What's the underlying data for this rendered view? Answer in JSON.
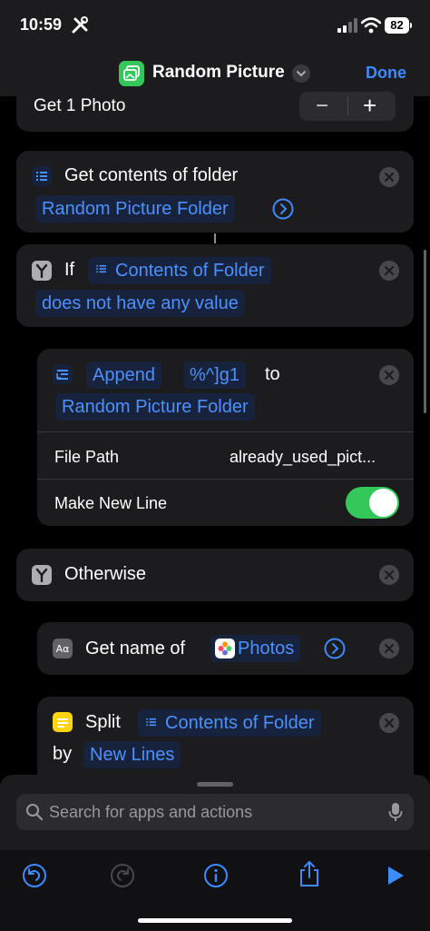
{
  "status": {
    "time": "10:59",
    "battery": "82"
  },
  "nav": {
    "title": "Random Picture",
    "done": "Done"
  },
  "get_photo": {
    "label": "Get 1 Photo",
    "minus": "−",
    "plus": "+"
  },
  "folder_action": {
    "label": "Get contents of folder",
    "folder": "Random Picture Folder"
  },
  "if_action": {
    "keyword": "If",
    "var": "Contents of Folder",
    "condition": "does not have any value"
  },
  "append_action": {
    "verb": "Append",
    "value": "%^]g1",
    "to": "to",
    "target": "Random Picture Folder",
    "file_path_label": "File Path",
    "file_path_value": "already_used_pict...",
    "new_line_label": "Make New Line",
    "new_line_on": true
  },
  "otherwise": {
    "label": "Otherwise"
  },
  "get_name": {
    "label": "Get name of",
    "value": "Photos"
  },
  "split": {
    "verb": "Split",
    "var": "Contents of Folder",
    "by": "by",
    "sep": "New Lines"
  },
  "search": {
    "placeholder": "Search for apps and actions"
  },
  "colors": {
    "accent": "#3d8bff",
    "toggle_on": "#34c759",
    "card": "#1c1c1e"
  },
  "icons": [
    "tools-icon",
    "signal-icon",
    "wifi-icon",
    "battery-icon",
    "photo-app-icon",
    "chevron-down-icon",
    "list-icon",
    "branch-icon",
    "append-icon",
    "text-icon",
    "photos-icon",
    "note-icon",
    "close-icon",
    "arrow-right-icon",
    "search-icon",
    "mic-icon",
    "undo-icon",
    "redo-icon",
    "info-icon",
    "share-icon",
    "play-icon"
  ]
}
